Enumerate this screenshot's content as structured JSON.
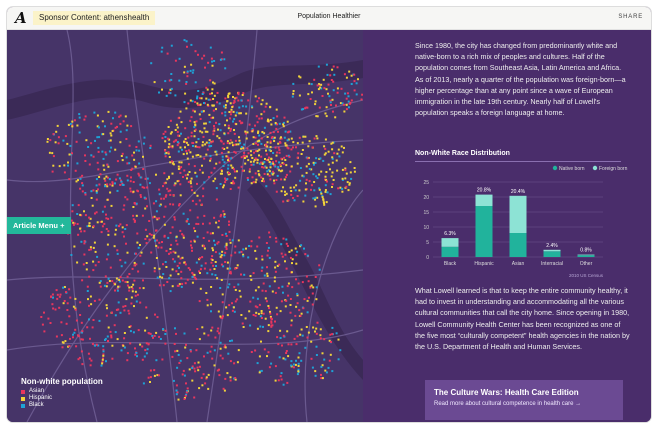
{
  "header": {
    "sponsor": "Sponsor Content: athenshealth",
    "title": "Population Healthier",
    "share": "SHARE"
  },
  "map": {
    "article_menu": "Article Menu",
    "legend_title": "Non-white population",
    "legend": [
      {
        "label": "Asian",
        "color": "#e8365e"
      },
      {
        "label": "Hispanic",
        "color": "#f2d33a"
      },
      {
        "label": "Black",
        "color": "#1ea2d6"
      }
    ]
  },
  "article": {
    "paragraph1": "Since 1980, the city has changed from predominantly white and native-born to a rich mix of peoples and cultures. Half of the population comes from Southeast Asia, Latin America and Africa. As of 2013, nearly a quarter of the population was foreign-born—a higher percentage than at any point since a wave of European immigration in the late 19th century. Nearly half of Lowell's population speaks a foreign language at home.",
    "paragraph2": "What Lowell learned is that to keep the entire community healthy, it had to invest in understanding and accommodating all the various cultural communities that call the city home. Since opening in 1980, Lowell Community Health Center has been recognized as one of the five most “culturally competent” health agencies in the nation by the U.S. Department of Health and Human Services.",
    "cta_title": "The Culture Wars: Health Care Edition",
    "cta_sub": "Read more about cultural competence in health care →"
  },
  "chart_data": {
    "type": "bar",
    "title": "Non-White Race Distribution",
    "categories": [
      "Black",
      "Hispanic",
      "Asian",
      "Interracial",
      "Other"
    ],
    "series": [
      {
        "name": "Native born",
        "values": [
          3.4,
          17.0,
          8.0,
          1.9,
          0.6
        ],
        "color": "#21b39c"
      },
      {
        "name": "Foreign born",
        "values": [
          2.9,
          3.8,
          12.4,
          0.5,
          0.2
        ],
        "color": "#8de3d5"
      }
    ],
    "totals": [
      "6.3%",
      "20.8%",
      "20.4%",
      "2.4%",
      "0.8%"
    ],
    "yticks": [
      "0",
      "5",
      "10",
      "15",
      "20",
      "25"
    ],
    "ylim": [
      0,
      25
    ],
    "source": "2010 US Census",
    "legend_position": "top-right"
  }
}
